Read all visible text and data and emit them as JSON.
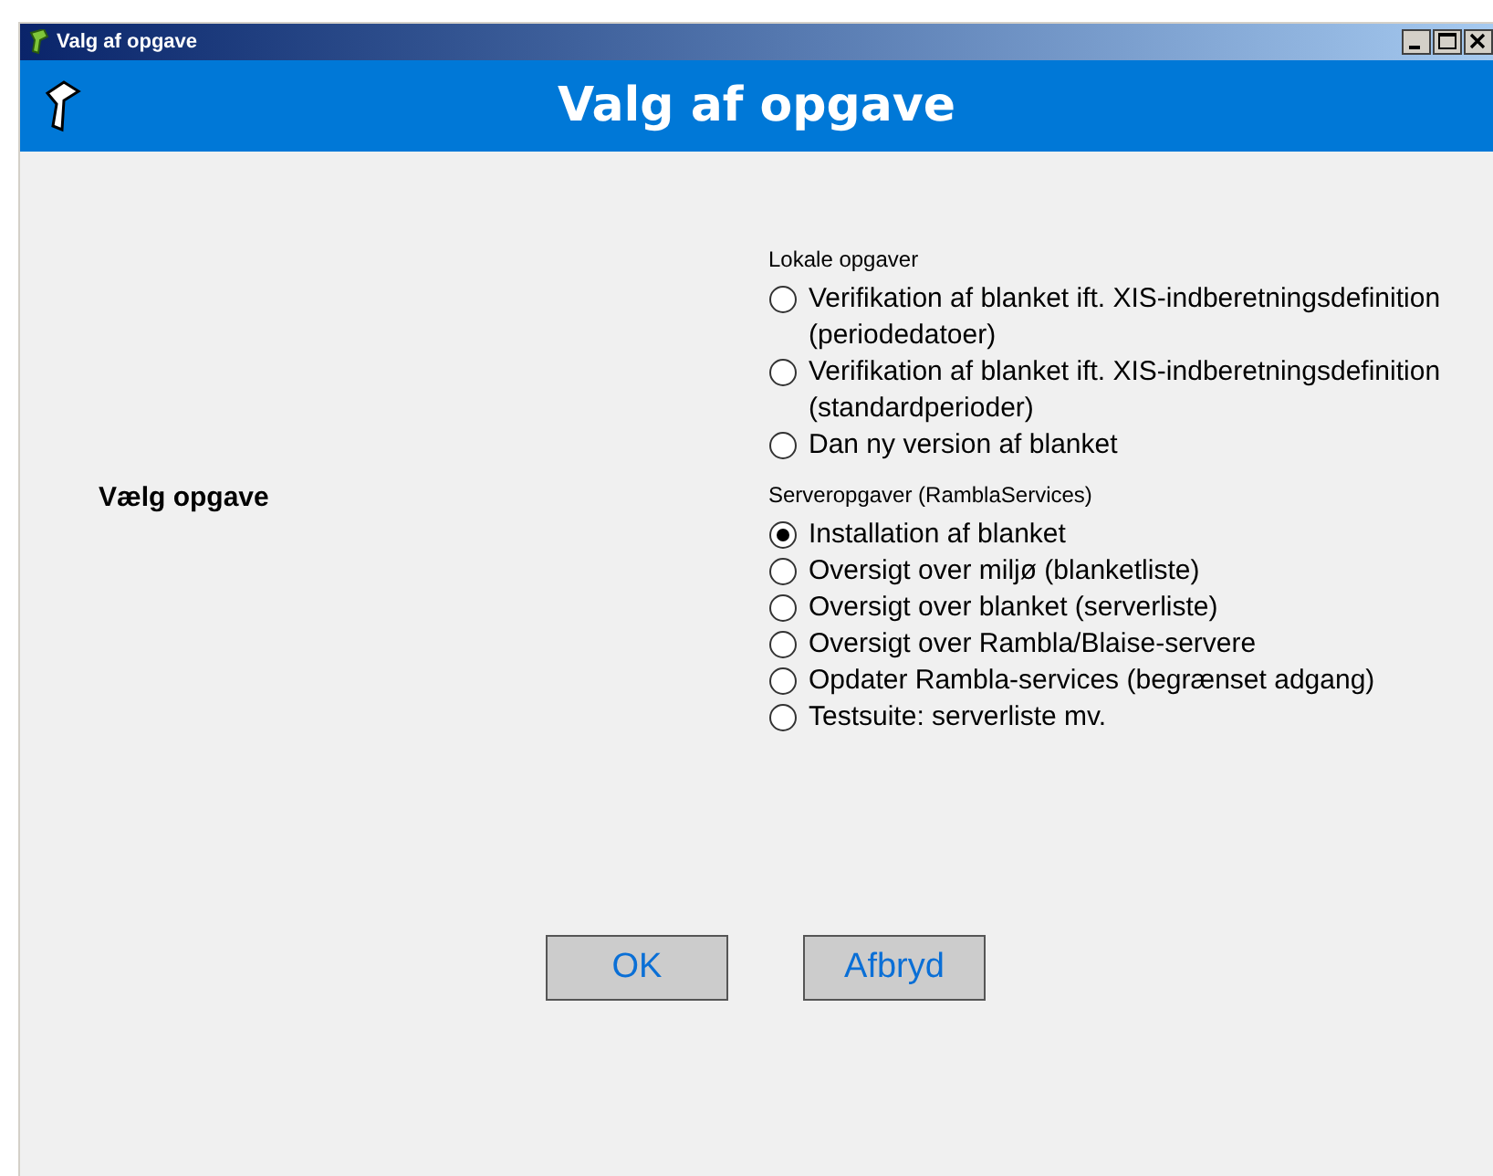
{
  "window": {
    "title": "Valg af opgave"
  },
  "header": {
    "title": "Valg af opgave"
  },
  "prompt": "Vælg opgave",
  "groups": [
    {
      "label": "Lokale opgaver",
      "options": [
        {
          "label": "Verifikation af blanket ift. XIS-indberetningsdefinition (periodedatoer)",
          "selected": false
        },
        {
          "label": "Verifikation af blanket ift. XIS-indberetningsdefinition (standardperioder)",
          "selected": false
        },
        {
          "label": "Dan ny version af blanket",
          "selected": false
        }
      ]
    },
    {
      "label": "Serveropgaver (RamblaServices)",
      "options": [
        {
          "label": "Installation af blanket",
          "selected": true
        },
        {
          "label": "Oversigt over miljø (blanketliste)",
          "selected": false
        },
        {
          "label": "Oversigt over blanket (serverliste)",
          "selected": false
        },
        {
          "label": "Oversigt over Rambla/Blaise-servere",
          "selected": false
        },
        {
          "label": "Opdater Rambla-services (begrænset adgang)",
          "selected": false
        },
        {
          "label": "Testsuite: serverliste mv.",
          "selected": false
        }
      ]
    }
  ],
  "buttons": [
    "OK",
    "Afbryd"
  ]
}
